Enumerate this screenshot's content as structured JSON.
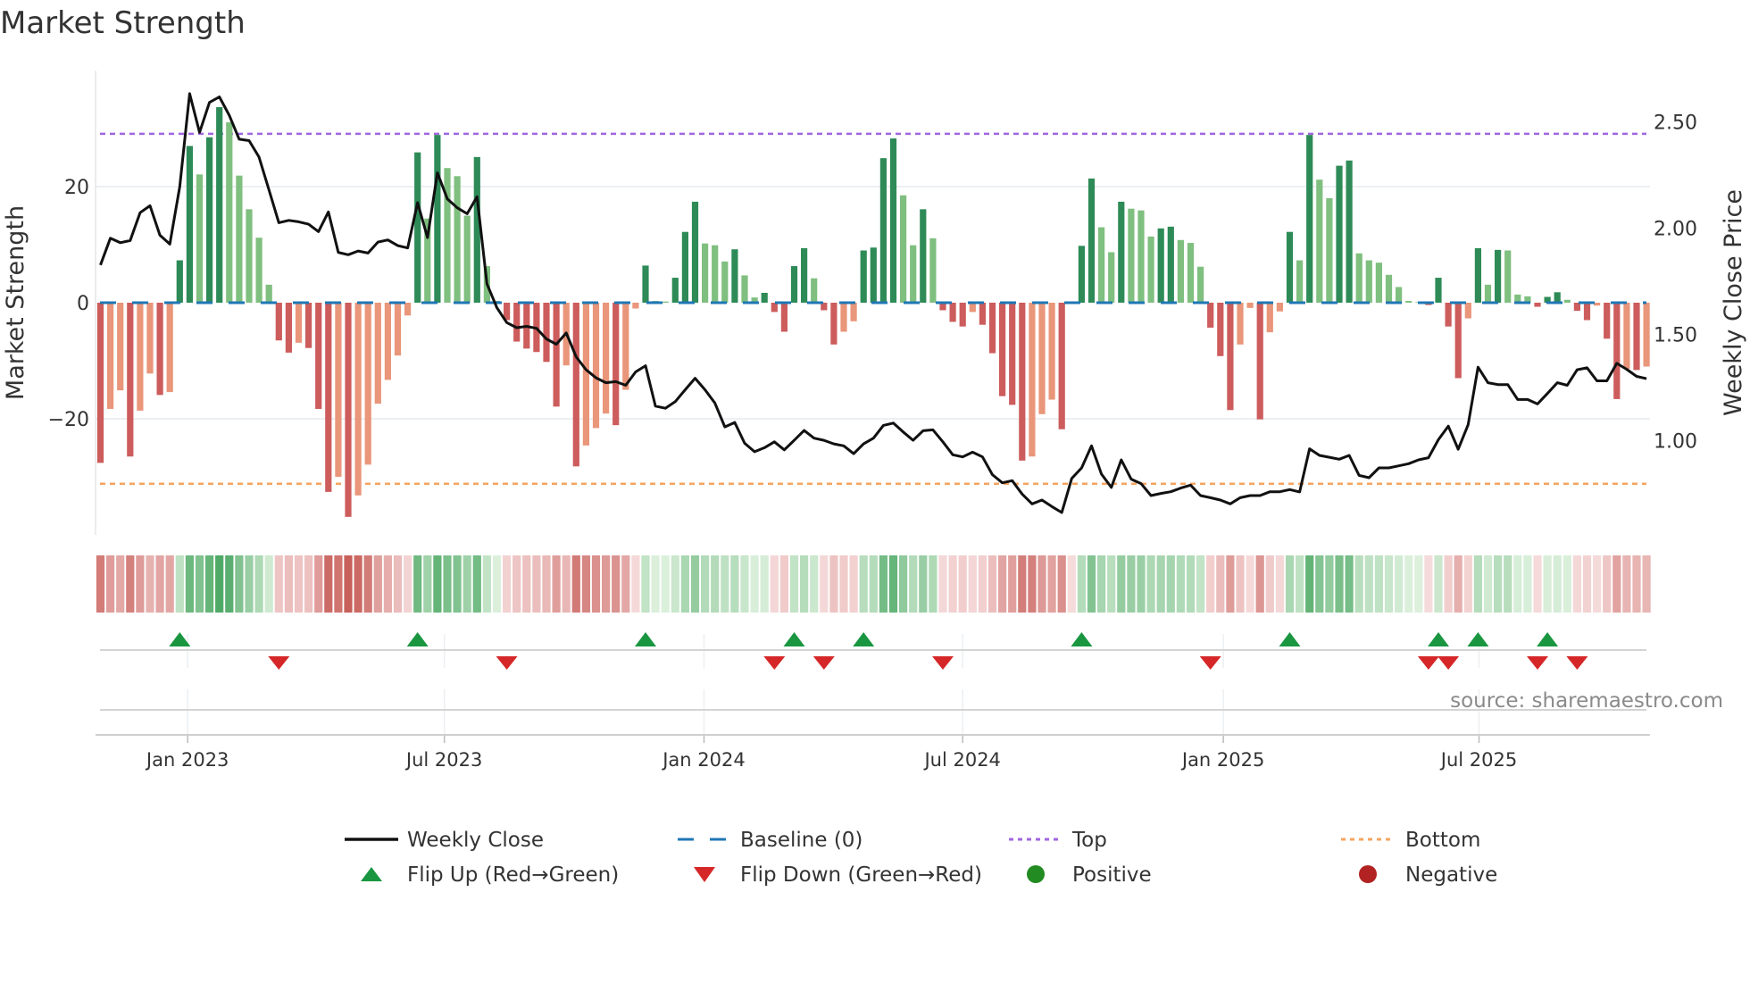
{
  "title": "Market Strength",
  "source": "source: sharemaestro.com",
  "colors": {
    "pos_dark": "#2e8b57",
    "pos_light": "#7fbf7f",
    "neg_dark": "#cd5c5c",
    "neg_light": "#e9967a",
    "top": "#a066e0",
    "bottom": "#f4a460",
    "baseline": "#1f77b4",
    "flip_up": "#1a9641",
    "flip_down": "#d62728",
    "positive": "#228b22",
    "negative": "#b22222",
    "close": "#111111"
  },
  "chart_data": {
    "type": "bar+line",
    "title": "Market Strength",
    "ylabel": "Market Strength",
    "y2label": "Weekly Close Price",
    "ylim": [
      -40,
      40
    ],
    "y2lim": [
      0.557,
      2.742
    ],
    "yticks": [
      {
        "v": 20,
        "label": "20"
      },
      {
        "v": 0,
        "label": "0"
      },
      {
        "v": -20,
        "label": "−20"
      }
    ],
    "y2ticks": [
      {
        "v": 2.5,
        "label": "2.50"
      },
      {
        "v": 2.0,
        "label": "2.00"
      },
      {
        "v": 1.5,
        "label": "1.50"
      },
      {
        "v": 1.0,
        "label": "1.00"
      }
    ],
    "xticks": [
      {
        "week": 8.8,
        "label": "Jan 2023"
      },
      {
        "week": 34.7,
        "label": "Jul 2023"
      },
      {
        "week": 60.9,
        "label": "Jan 2024"
      },
      {
        "week": 87.0,
        "label": "Jul 2024"
      },
      {
        "week": 113.3,
        "label": "Jan 2025"
      },
      {
        "week": 139.1,
        "label": "Jul 2025"
      }
    ],
    "top": 29.1,
    "bottom": -31.2,
    "baseline": 0,
    "strength": [
      -27.6,
      -18.3,
      -15.1,
      -26.5,
      -18.6,
      -12.2,
      -15.9,
      -15.4,
      7.3,
      27.0,
      22.1,
      28.5,
      33.7,
      31.1,
      21.9,
      16.1,
      11.2,
      3.1,
      -6.5,
      -8.6,
      -6.9,
      -7.8,
      -18.3,
      -32.6,
      -30.0,
      -36.9,
      -33.2,
      -27.9,
      -17.4,
      -13.3,
      -9.1,
      -2.2,
      25.9,
      14.5,
      28.9,
      23.2,
      21.8,
      15.0,
      25.1,
      6.3,
      0.3,
      -3.0,
      -6.7,
      -7.9,
      -8.5,
      -10.2,
      -17.9,
      -10.8,
      -28.2,
      -24.6,
      -21.6,
      -19.1,
      -21.1,
      -15.0,
      -1.0,
      6.4,
      0.3,
      0.2,
      4.3,
      12.2,
      17.4,
      10.2,
      9.9,
      7.1,
      9.2,
      4.7,
      0.9,
      1.7,
      -1.6,
      -5.0,
      6.3,
      9.4,
      4.2,
      -1.3,
      -7.2,
      -5.0,
      -3.2,
      9.0,
      9.5,
      24.9,
      28.3,
      18.5,
      9.9,
      16.1,
      11.1,
      -1.3,
      -3.3,
      -4.1,
      -1.6,
      -3.8,
      -8.7,
      -16.1,
      -17.6,
      -27.2,
      -26.5,
      -19.2,
      -16.7,
      -21.8,
      -0.2,
      9.8,
      21.4,
      13.0,
      8.7,
      17.4,
      16.2,
      15.9,
      11.4,
      12.8,
      13.1,
      10.8,
      10.3,
      6.2,
      -4.3,
      -9.2,
      -18.5,
      -7.2,
      -0.9,
      -20.1,
      -5.1,
      -1.5,
      12.2,
      7.3,
      28.9,
      21.2,
      18.0,
      23.6,
      24.5,
      8.5,
      7.3,
      6.9,
      4.8,
      2.7,
      0.3,
      0.1,
      -0.4,
      4.3,
      -4.1,
      -13.0,
      -2.7,
      9.4,
      3.1,
      9.1,
      9.0,
      1.4,
      1.1,
      -0.7,
      1.0,
      1.8,
      0.5,
      -1.4,
      -3.0,
      -0.5,
      -6.2,
      -16.6,
      -11.4,
      -11.6,
      -11.0
    ],
    "weekly_close": [
      1.827,
      1.953,
      1.932,
      1.942,
      2.073,
      2.106,
      1.967,
      1.925,
      2.195,
      2.633,
      2.451,
      2.592,
      2.618,
      2.531,
      2.419,
      2.412,
      2.335,
      2.181,
      2.026,
      2.037,
      2.03,
      2.019,
      1.984,
      2.077,
      1.886,
      1.875,
      1.893,
      1.883,
      1.935,
      1.945,
      1.918,
      1.907,
      2.12,
      1.956,
      2.261,
      2.138,
      2.096,
      2.068,
      2.148,
      1.738,
      1.626,
      1.556,
      1.532,
      1.538,
      1.529,
      1.479,
      1.454,
      1.507,
      1.395,
      1.334,
      1.296,
      1.273,
      1.278,
      1.261,
      1.324,
      1.353,
      1.163,
      1.153,
      1.184,
      1.24,
      1.294,
      1.24,
      1.177,
      1.065,
      1.086,
      0.988,
      0.948,
      0.967,
      0.995,
      0.957,
      1.002,
      1.048,
      1.012,
      1.002,
      0.985,
      0.976,
      0.939,
      0.985,
      1.012,
      1.072,
      1.083,
      1.041,
      1.002,
      1.047,
      1.051,
      0.995,
      0.934,
      0.924,
      0.946,
      0.924,
      0.84,
      0.802,
      0.812,
      0.749,
      0.703,
      0.721,
      0.69,
      0.662,
      0.822,
      0.872,
      0.976,
      0.843,
      0.78,
      0.91,
      0.819,
      0.798,
      0.742,
      0.752,
      0.76,
      0.777,
      0.791,
      0.742,
      0.732,
      0.721,
      0.703,
      0.732,
      0.742,
      0.742,
      0.76,
      0.76,
      0.77,
      0.759,
      0.962,
      0.931,
      0.922,
      0.913,
      0.931,
      0.837,
      0.826,
      0.872,
      0.872,
      0.882,
      0.892,
      0.91,
      0.92,
      1.005,
      1.069,
      0.96,
      1.075,
      1.346,
      1.273,
      1.264,
      1.264,
      1.194,
      1.194,
      1.173,
      1.222,
      1.273,
      1.261,
      1.334,
      1.343,
      1.282,
      1.282,
      1.364,
      1.336,
      1.303,
      1.292
    ],
    "flip_up_weeks": [
      9,
      33,
      56,
      71,
      78,
      100,
      121,
      136,
      140,
      147
    ],
    "flip_down_weeks": [
      19,
      42,
      69,
      74,
      86,
      113,
      135,
      137,
      146,
      150
    ],
    "legend": [
      {
        "key": "close",
        "label": "Weekly Close"
      },
      {
        "key": "baseline",
        "label": "Baseline (0)"
      },
      {
        "key": "top",
        "label": "Top"
      },
      {
        "key": "bottom",
        "label": "Bottom"
      },
      {
        "key": "flip_up",
        "label": "Flip Up (Red→Green)"
      },
      {
        "key": "flip_down",
        "label": "Flip Down (Green→Red)"
      },
      {
        "key": "positive",
        "label": "Positive"
      },
      {
        "key": "negative",
        "label": "Negative"
      }
    ]
  }
}
